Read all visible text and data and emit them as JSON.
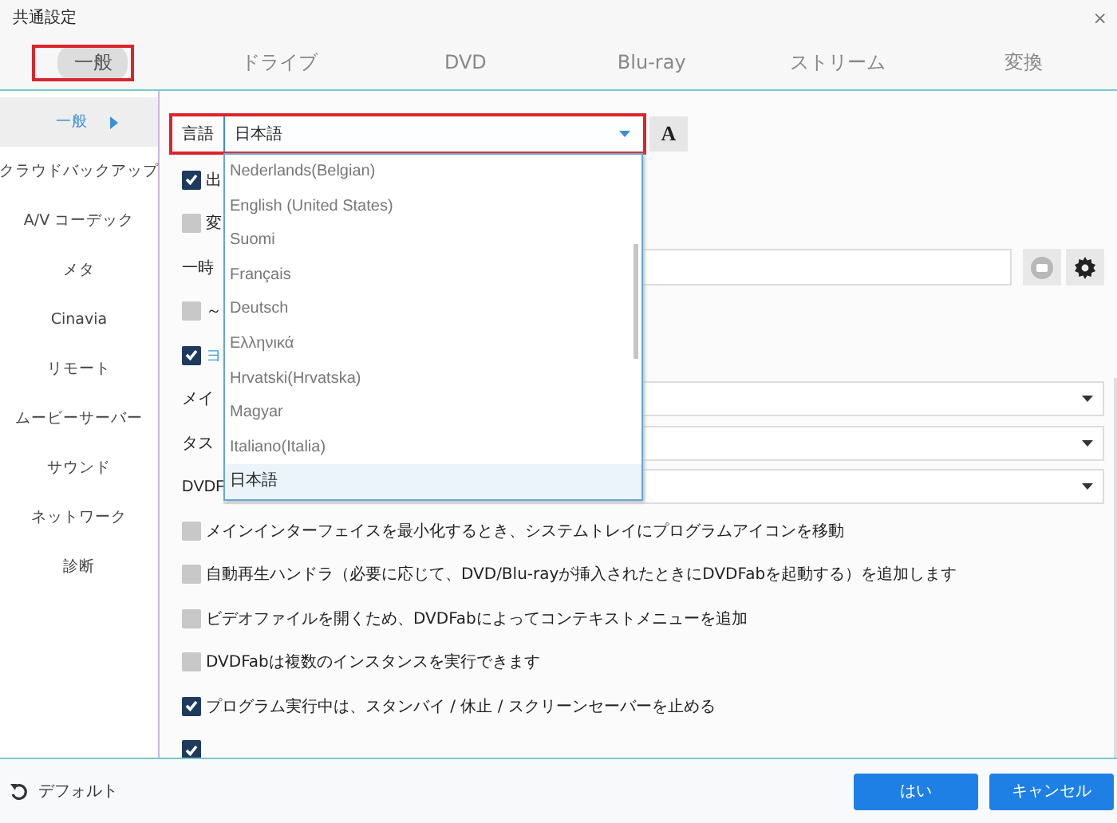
{
  "window": {
    "title": "共通設定",
    "close": "×"
  },
  "tabs": [
    {
      "label": "一般",
      "selected": true,
      "highlighted": true
    },
    {
      "label": "ドライブ",
      "selected": false,
      "highlighted": false
    },
    {
      "label": "DVD",
      "selected": false,
      "highlighted": false
    },
    {
      "label": "Blu-ray",
      "selected": false,
      "highlighted": false
    },
    {
      "label": "ストリーム",
      "selected": false,
      "highlighted": false
    },
    {
      "label": "変換",
      "selected": false,
      "highlighted": false
    }
  ],
  "sidebar": {
    "items": [
      {
        "label": "一般",
        "selected": true
      },
      {
        "label": "クラウドバックアップ",
        "selected": false
      },
      {
        "label": "A/V コーデック",
        "selected": false
      },
      {
        "label": "メタ",
        "selected": false
      },
      {
        "label": "Cinavia",
        "selected": false
      },
      {
        "label": "リモート",
        "selected": false
      },
      {
        "label": "ムービーサーバー",
        "selected": false
      },
      {
        "label": "サウンド",
        "selected": false
      },
      {
        "label": "ネットワーク",
        "selected": false
      },
      {
        "label": "診断",
        "selected": false
      }
    ]
  },
  "language": {
    "label": "言語",
    "value": "日本語",
    "highlighted": true,
    "expanded": true,
    "font_button": "A",
    "options": [
      {
        "label": "Nederlands(Belgian)",
        "selected": false
      },
      {
        "label": "English (United States)",
        "selected": false
      },
      {
        "label": "Suomi",
        "selected": false
      },
      {
        "label": "Français",
        "selected": false
      },
      {
        "label": "Deutsch",
        "selected": false
      },
      {
        "label": "Ελληνικά",
        "selected": false
      },
      {
        "label": "Hrvatski(Hrvatska)",
        "selected": false
      },
      {
        "label": "Magyar",
        "selected": false
      },
      {
        "label": "Italiano(Italia)",
        "selected": false
      },
      {
        "label": "日本語",
        "selected": true
      }
    ]
  },
  "settings": [
    {
      "kind": "check",
      "text": "出",
      "checked": true
    },
    {
      "kind": "check",
      "text": "変",
      "checked": false
    },
    {
      "kind": "path",
      "label": "一時"
    },
    {
      "kind": "check",
      "text": "～",
      "checked": false
    },
    {
      "kind": "check",
      "text": "ヨ",
      "checked": true,
      "link": true
    },
    {
      "kind": "select",
      "label": "メイ"
    },
    {
      "kind": "select",
      "label": "タス"
    },
    {
      "kind": "select",
      "label": "DVDF"
    },
    {
      "kind": "check",
      "text": "メインインターフェイスを最小化するとき、システムトレイにプログラムアイコンを移動",
      "checked": false
    },
    {
      "kind": "check",
      "text": "自動再生ハンドラ（必要に応じて、DVD/Blu-rayが挿入されたときにDVDFabを起動する）を追加します",
      "checked": false
    },
    {
      "kind": "check",
      "text": "ビデオファイルを開くため、DVDFabによってコンテキストメニューを追加",
      "checked": false
    },
    {
      "kind": "check",
      "text": "DVDFabは複数のインスタンスを実行できます",
      "checked": false
    },
    {
      "kind": "check",
      "text": "プログラム実行中は、スタンバイ / 休止 / スクリーンセーバーを止める",
      "checked": true
    },
    {
      "kind": "check",
      "checked": true
    }
  ],
  "footer": {
    "default": "デフォルト",
    "ok": "はい",
    "cancel": "キャンセル"
  }
}
